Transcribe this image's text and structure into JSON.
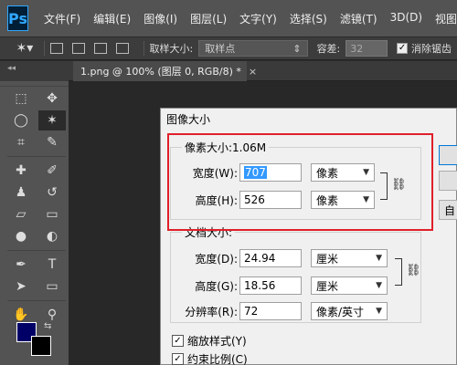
{
  "app": {
    "logo": "Ps"
  },
  "menu": [
    "文件(F)",
    "编辑(E)",
    "图像(I)",
    "图层(L)",
    "文字(Y)",
    "选择(S)",
    "滤镜(T)",
    "3D(D)",
    "视图(V)"
  ],
  "options_bar": {
    "sample_size_label": "取样大小:",
    "sample_size_value": "取样点",
    "tolerance_label": "容差:",
    "tolerance_value": "32",
    "antialias_label": "消除锯齿",
    "antialias_checked": true
  },
  "toolbox_header": "◂◂",
  "document_tab": {
    "title": "1.png @ 100% (图层 0, RGB/8) *",
    "close": "×"
  },
  "colors": {
    "foreground": "#000066",
    "background": "#000000",
    "highlight": "#e0202a"
  },
  "dialog": {
    "title": "图像大小",
    "pixel_dimensions": {
      "title": "像素大小:1.06M",
      "width_label": "宽度(W):",
      "width_value": "707",
      "width_unit": "像素",
      "height_label": "高度(H):",
      "height_value": "526",
      "height_unit": "像素"
    },
    "document_size": {
      "title": "文档大小:",
      "width_label": "宽度(D):",
      "width_value": "24.94",
      "width_unit": "厘米",
      "height_label": "高度(G):",
      "height_value": "18.56",
      "height_unit": "厘米",
      "resolution_label": "分辨率(R):",
      "resolution_value": "72",
      "resolution_unit": "像素/英寸"
    },
    "scale_styles_label": "缩放样式(Y)",
    "scale_styles_checked": true,
    "constrain_label": "约束比例(C)",
    "constrain_checked": true,
    "side_button_3_label": "自"
  }
}
